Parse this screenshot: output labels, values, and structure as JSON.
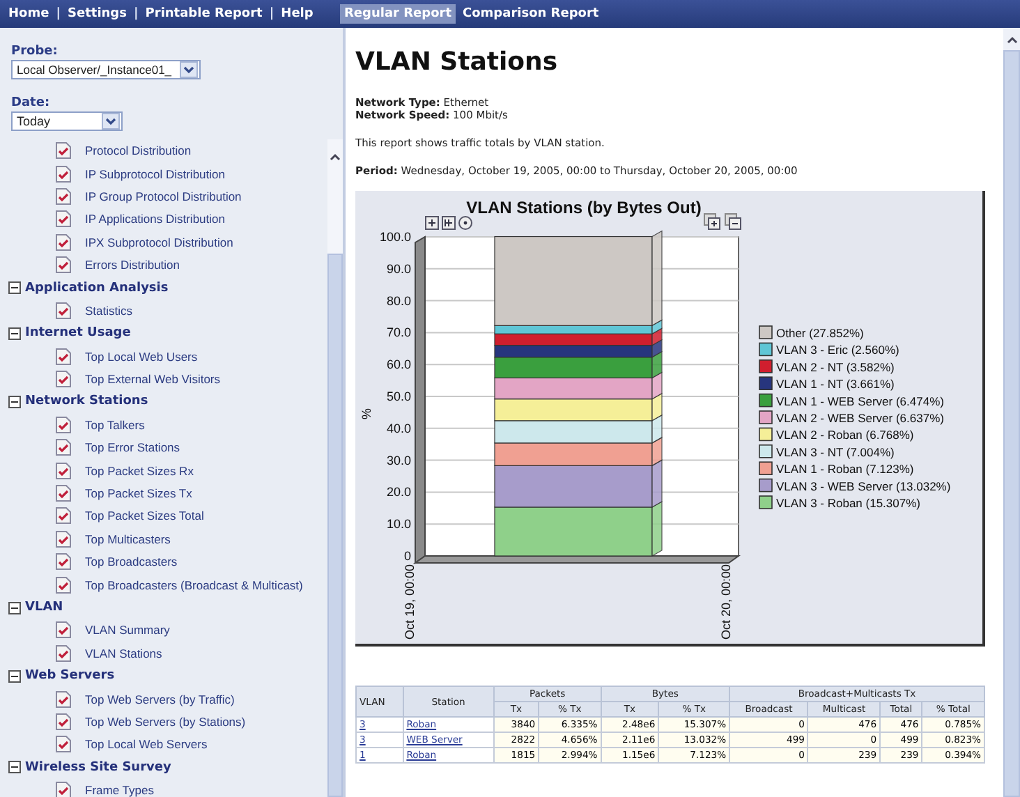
{
  "nav": {
    "links": [
      {
        "label": "Home"
      },
      {
        "label": "Settings"
      },
      {
        "label": "Printable Report"
      },
      {
        "label": "Help"
      }
    ],
    "separator": "|"
  },
  "tabs": [
    {
      "label": "Regular Report",
      "selected": true
    },
    {
      "label": "Comparison Report",
      "selected": false
    }
  ],
  "sidebar": {
    "probe": {
      "label": "Probe:",
      "value": "Local Observer/_Instance01_"
    },
    "date": {
      "label": "Date:",
      "value": "Today"
    },
    "tree": [
      {
        "label": "Protocol Distribution"
      },
      {
        "label": "IP Subprotocol Distribution"
      },
      {
        "label": "IP Group Protocol Distribution"
      },
      {
        "label": "IP Applications Distribution"
      },
      {
        "label": "IPX Subprotocol Distribution"
      },
      {
        "label": "Errors Distribution"
      },
      {
        "label": "Application Analysis",
        "expanded": true,
        "children": [
          {
            "label": "Statistics"
          }
        ]
      },
      {
        "label": "Internet Usage",
        "expanded": true,
        "children": [
          {
            "label": "Top Local Web Users"
          },
          {
            "label": "Top External Web Visitors"
          }
        ]
      },
      {
        "label": "Network Stations",
        "expanded": true,
        "children": [
          {
            "label": "Top Talkers"
          },
          {
            "label": "Top Error Stations"
          },
          {
            "label": "Top Packet Sizes Rx"
          },
          {
            "label": "Top Packet Sizes Tx"
          },
          {
            "label": "Top Packet Sizes Total"
          },
          {
            "label": "Top Multicasters"
          },
          {
            "label": "Top Broadcasters"
          },
          {
            "label": "Top Broadcasters (Broadcast & Multicast)"
          }
        ]
      },
      {
        "label": "VLAN",
        "expanded": true,
        "children": [
          {
            "label": "VLAN Summary"
          },
          {
            "label": "VLAN Stations"
          }
        ]
      },
      {
        "label": "Web Servers",
        "expanded": true,
        "children": [
          {
            "label": "Top Web Servers (by Traffic)"
          },
          {
            "label": "Top Web Servers (by Stations)"
          },
          {
            "label": "Top Local Web Servers"
          }
        ]
      },
      {
        "label": "Wireless Site Survey",
        "expanded": true,
        "children": [
          {
            "label": "Frame Types"
          }
        ]
      }
    ]
  },
  "report": {
    "title": "VLAN Stations",
    "info": [
      "**Network Type:** Ethernet",
      "**Network Speed:** 100 Mbit/s"
    ],
    "description": "This report shows traffic totals by VLAN station.",
    "period": "**Period:** Wednesday, October 19, 2005, 00:00 to Thursday, October 20, 2005, 00:00",
    "chart_data": {
      "type": "bar",
      "stacked": true,
      "grid": true,
      "legend": true,
      "title": "VLAN Stations (by Bytes Out)",
      "ylabel": "%",
      "ylim": [
        0,
        100
      ],
      "yticks": [
        {
          "value": 0,
          "label": "0"
        },
        {
          "value": 10,
          "label": "10.0"
        },
        {
          "value": 20,
          "label": "20.0"
        },
        {
          "value": 30,
          "label": "30.0"
        },
        {
          "value": 40,
          "label": "40.0"
        },
        {
          "value": 50,
          "label": "50.0"
        },
        {
          "value": 60,
          "label": "60.0"
        },
        {
          "value": 70,
          "label": "70.0"
        },
        {
          "value": 80,
          "label": "80.0"
        },
        {
          "value": 90,
          "label": "90.0"
        },
        {
          "value": 100,
          "label": "100.0"
        }
      ],
      "categories": [
        null
      ],
      "annotations": [
        {
          "text": "Oct 19, 00:00"
        },
        {
          "text": "Oct 20, 00:00"
        }
      ],
      "series": [
        {
          "name": "VLAN 3 - Roban (15.307%)",
          "color": "#8fd08a",
          "values": [
            15.3
          ]
        },
        {
          "name": "VLAN 3 - WEB Server (13.032%)",
          "color": "#a79ccb",
          "values": [
            13.0
          ]
        },
        {
          "name": "VLAN 1 - Roban (7.123%)",
          "color": "#f0a092",
          "values": [
            7.1
          ]
        },
        {
          "name": "VLAN 3 - NT (7.004%)",
          "color": "#cde8ec",
          "values": [
            7.0
          ]
        },
        {
          "name": "VLAN 2 - Roban (6.768%)",
          "color": "#f5ef98",
          "values": [
            6.8
          ]
        },
        {
          "name": "VLAN 2 - WEB Server (6.637%)",
          "color": "#e3a5c5",
          "values": [
            6.6
          ]
        },
        {
          "name": "VLAN 1 - WEB Server (6.474%)",
          "color": "#3a9f3e",
          "values": [
            6.5
          ]
        },
        {
          "name": "VLAN 1 - NT (3.661%)",
          "color": "#27357e",
          "values": [
            3.7
          ]
        },
        {
          "name": "VLAN 2 - NT (3.582%)",
          "color": "#d01e2e",
          "values": [
            3.6
          ]
        },
        {
          "name": "VLAN 3 - Eric (2.560%)",
          "color": "#5fc6d6",
          "values": [
            2.6
          ]
        },
        {
          "name": "Other (27.852%)",
          "color": "#cdc8c4",
          "values": [
            27.9
          ]
        }
      ]
    },
    "table": {
      "groups": [
        {
          "label": "VLAN"
        },
        {
          "label": "Station"
        },
        {
          "label": "Packets",
          "columns": [
            "Tx",
            "% Tx"
          ]
        },
        {
          "label": "Bytes",
          "columns": [
            "Tx",
            "% Tx"
          ]
        },
        {
          "label": "Broadcast+Multicasts Tx",
          "columns": [
            "Broadcast",
            "Multicast",
            "Total",
            "% Total"
          ]
        }
      ],
      "rows": [
        {
          "vlan": "3",
          "station": "Roban",
          "cells": [
            "3840",
            "6.335%",
            "2.48e6",
            "15.307%",
            "0",
            "476",
            "476",
            "0.785%"
          ]
        },
        {
          "vlan": "3",
          "station": "WEB Server",
          "cells": [
            "2822",
            "4.656%",
            "2.11e6",
            "13.032%",
            "499",
            "0",
            "499",
            "0.823%"
          ]
        },
        {
          "vlan": "1",
          "station": "Roban",
          "cells": [
            "1815",
            "2.994%",
            "1.15e6",
            "7.123%",
            "0",
            "239",
            "239",
            "0.394%"
          ]
        }
      ]
    }
  }
}
